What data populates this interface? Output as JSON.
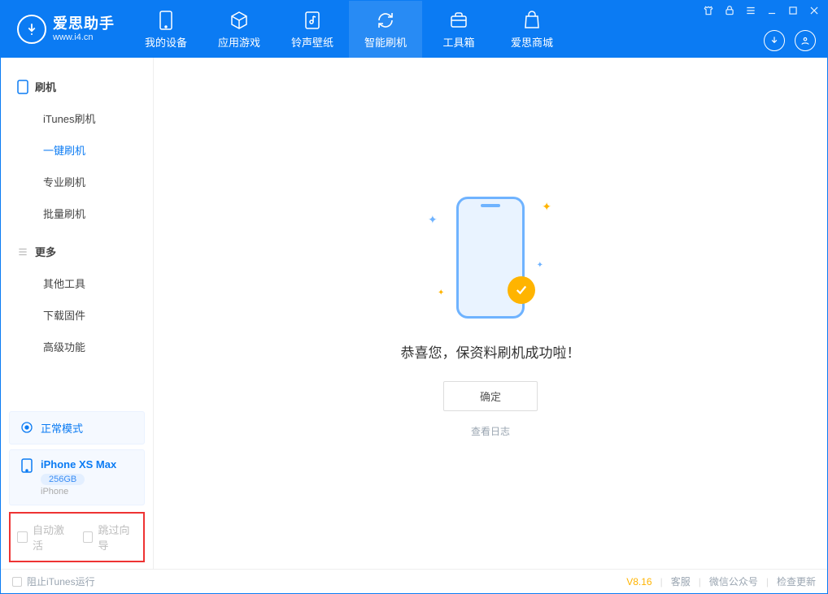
{
  "app": {
    "name": "爱思助手",
    "url": "www.i4.cn"
  },
  "topnav": {
    "device": "我的设备",
    "apps": "应用游戏",
    "rings": "铃声壁纸",
    "flash": "智能刷机",
    "toolbox": "工具箱",
    "store": "爱思商城"
  },
  "sidebar": {
    "section_flash": "刷机",
    "items_flash": {
      "itunes": "iTunes刷机",
      "oneclick": "一键刷机",
      "pro": "专业刷机",
      "batch": "批量刷机"
    },
    "section_more": "更多",
    "items_more": {
      "other": "其他工具",
      "firmware": "下载固件",
      "advanced": "高级功能"
    },
    "mode_card": "正常模式",
    "device": {
      "name": "iPhone XS Max",
      "capacity": "256GB",
      "type": "iPhone"
    },
    "checks": {
      "auto_activate": "自动激活",
      "skip_wizard": "跳过向导"
    }
  },
  "main": {
    "success_msg": "恭喜您，保资料刷机成功啦！",
    "ok_btn": "确定",
    "view_log": "查看日志"
  },
  "status": {
    "block_itunes": "阻止iTunes运行",
    "version": "V8.16",
    "support": "客服",
    "wechat": "微信公众号",
    "update": "检查更新"
  }
}
